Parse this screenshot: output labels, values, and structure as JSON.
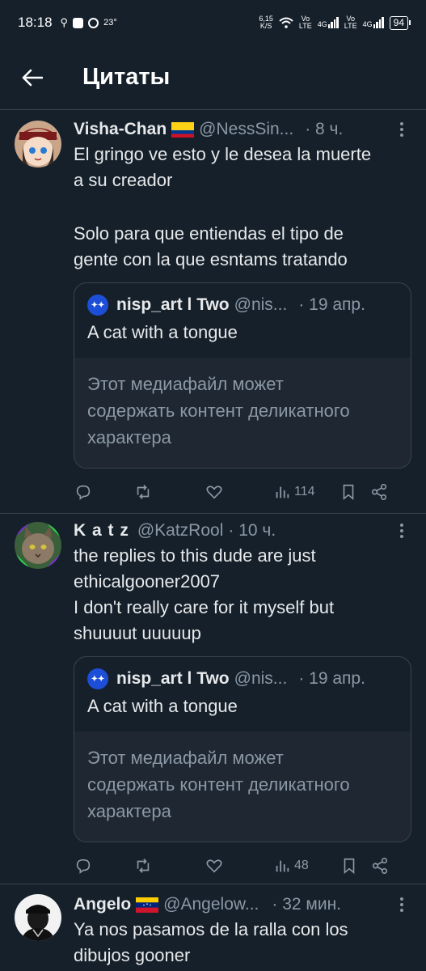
{
  "status_bar": {
    "time": "18:18",
    "temp": "23°",
    "speed_value": "6,15",
    "speed_unit": "K/S",
    "net1_top": "Vo",
    "net1_bottom": "LTE",
    "net1_g": "4G",
    "net2_top": "Vo",
    "net2_bottom": "LTE",
    "net2_g": "4G",
    "battery": "94"
  },
  "header": {
    "title": "Цитаты"
  },
  "tweets": [
    {
      "name": "Visha-Chan",
      "handle": "@NessSin...",
      "time": "· 8 ч.",
      "text_lines": [
        "El gringo ve esto y le desea la muerte",
        "a su creador",
        "",
        "Solo para que entiendas el tipo de",
        "gente con la que esntams tratando"
      ],
      "quote": {
        "name": "nisp_art l Two",
        "handle": "@nis...",
        "time": "· 19 апр.",
        "text": "A cat with a tongue",
        "media_warning_lines": [
          "Этот медиафайл может",
          "содержать контент деликатного",
          "характера"
        ]
      },
      "views": "114"
    },
    {
      "name": "K a t z",
      "handle": "@KatzRool",
      "time": "· 10 ч.",
      "text_lines": [
        "the replies to this dude are just",
        "ethicalgooner2007",
        "I don't really care for it myself but",
        "shuuuut uuuuup"
      ],
      "quote": {
        "name": "nisp_art l Two",
        "handle": "@nis...",
        "time": "· 19 апр.",
        "text": "A cat with a tongue",
        "media_warning_lines": [
          "Этот медиафайл может",
          "содержать контент деликатного",
          "характера"
        ]
      },
      "views": "48"
    },
    {
      "name": "Angelo",
      "handle": "@Angelow...",
      "time": "· 32 мин.",
      "text_lines": [
        "Ya nos pasamos de la ralla con los",
        "dibujos gooner"
      ]
    }
  ],
  "colors": {
    "background": "#15202b",
    "divider": "#38444d",
    "muted": "#8b98a5",
    "media_bg": "#1e2732"
  }
}
